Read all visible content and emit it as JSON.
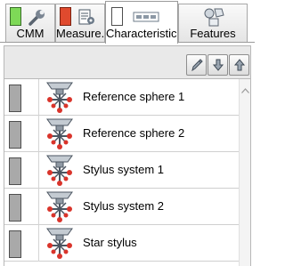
{
  "tabs": [
    {
      "label": "CMM",
      "icon": "wrench-icon",
      "indicator_color": "#7ed957",
      "active": false
    },
    {
      "label": "Measure...",
      "icon": "report-icon",
      "indicator_color": "#e04a2e",
      "active": false
    },
    {
      "label": "Characteristics",
      "icon": "dimension-icon",
      "indicator_color": "#ffffff",
      "active": true
    },
    {
      "label": "Features",
      "icon": "features-icon",
      "active": false
    }
  ],
  "toolbar": {
    "buttons": [
      {
        "name": "edit-pencil-button",
        "icon": "pencil-icon"
      },
      {
        "name": "move-down-button",
        "icon": "arrow-down-icon"
      },
      {
        "name": "move-up-button",
        "icon": "arrow-up-icon"
      }
    ]
  },
  "list": {
    "items": [
      {
        "label": "Reference sphere 1",
        "icon": "stylus-icon"
      },
      {
        "label": "Reference sphere 2",
        "icon": "stylus-icon"
      },
      {
        "label": "Stylus system 1",
        "icon": "stylus-icon"
      },
      {
        "label": "Stylus system 2",
        "icon": "stylus-icon"
      },
      {
        "label": "Star stylus",
        "icon": "stylus-icon"
      }
    ]
  },
  "colors": {
    "stylus_tip": "#d9342b",
    "swatch": "#a9a9a9"
  }
}
